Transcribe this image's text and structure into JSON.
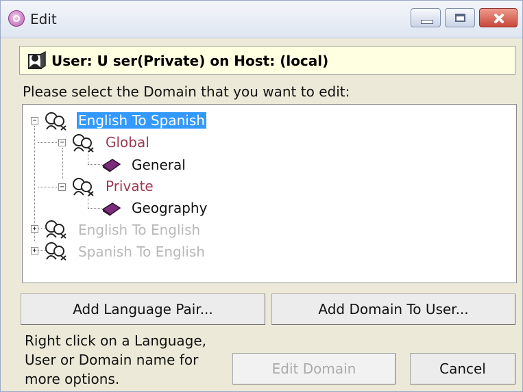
{
  "window": {
    "title": "Edit"
  },
  "user_info": "User: U ser(Private) on Host: (local)",
  "prompt": "Please select the Domain that you want to edit:",
  "tree": {
    "nodes": [
      {
        "label": "English To Spanish",
        "expanded": true,
        "selected": true
      },
      {
        "label": "Global",
        "expanded": true
      },
      {
        "label": "General"
      },
      {
        "label": "Private",
        "expanded": true
      },
      {
        "label": "Geography"
      },
      {
        "label": "English To English",
        "expanded": false
      },
      {
        "label": "Spanish To English",
        "expanded": false
      }
    ]
  },
  "buttons": {
    "add_language_pair": "Add Language Pair...",
    "add_domain_to_user": "Add Domain To User...",
    "edit_domain": "Edit Domain",
    "cancel": "Cancel"
  },
  "help_text": "Right click on a Language, User or Domain name for more options.",
  "colors": {
    "selection": "#3399ff",
    "maroon_text": "#9b3a52",
    "disabled_text": "#b8b8b8"
  }
}
